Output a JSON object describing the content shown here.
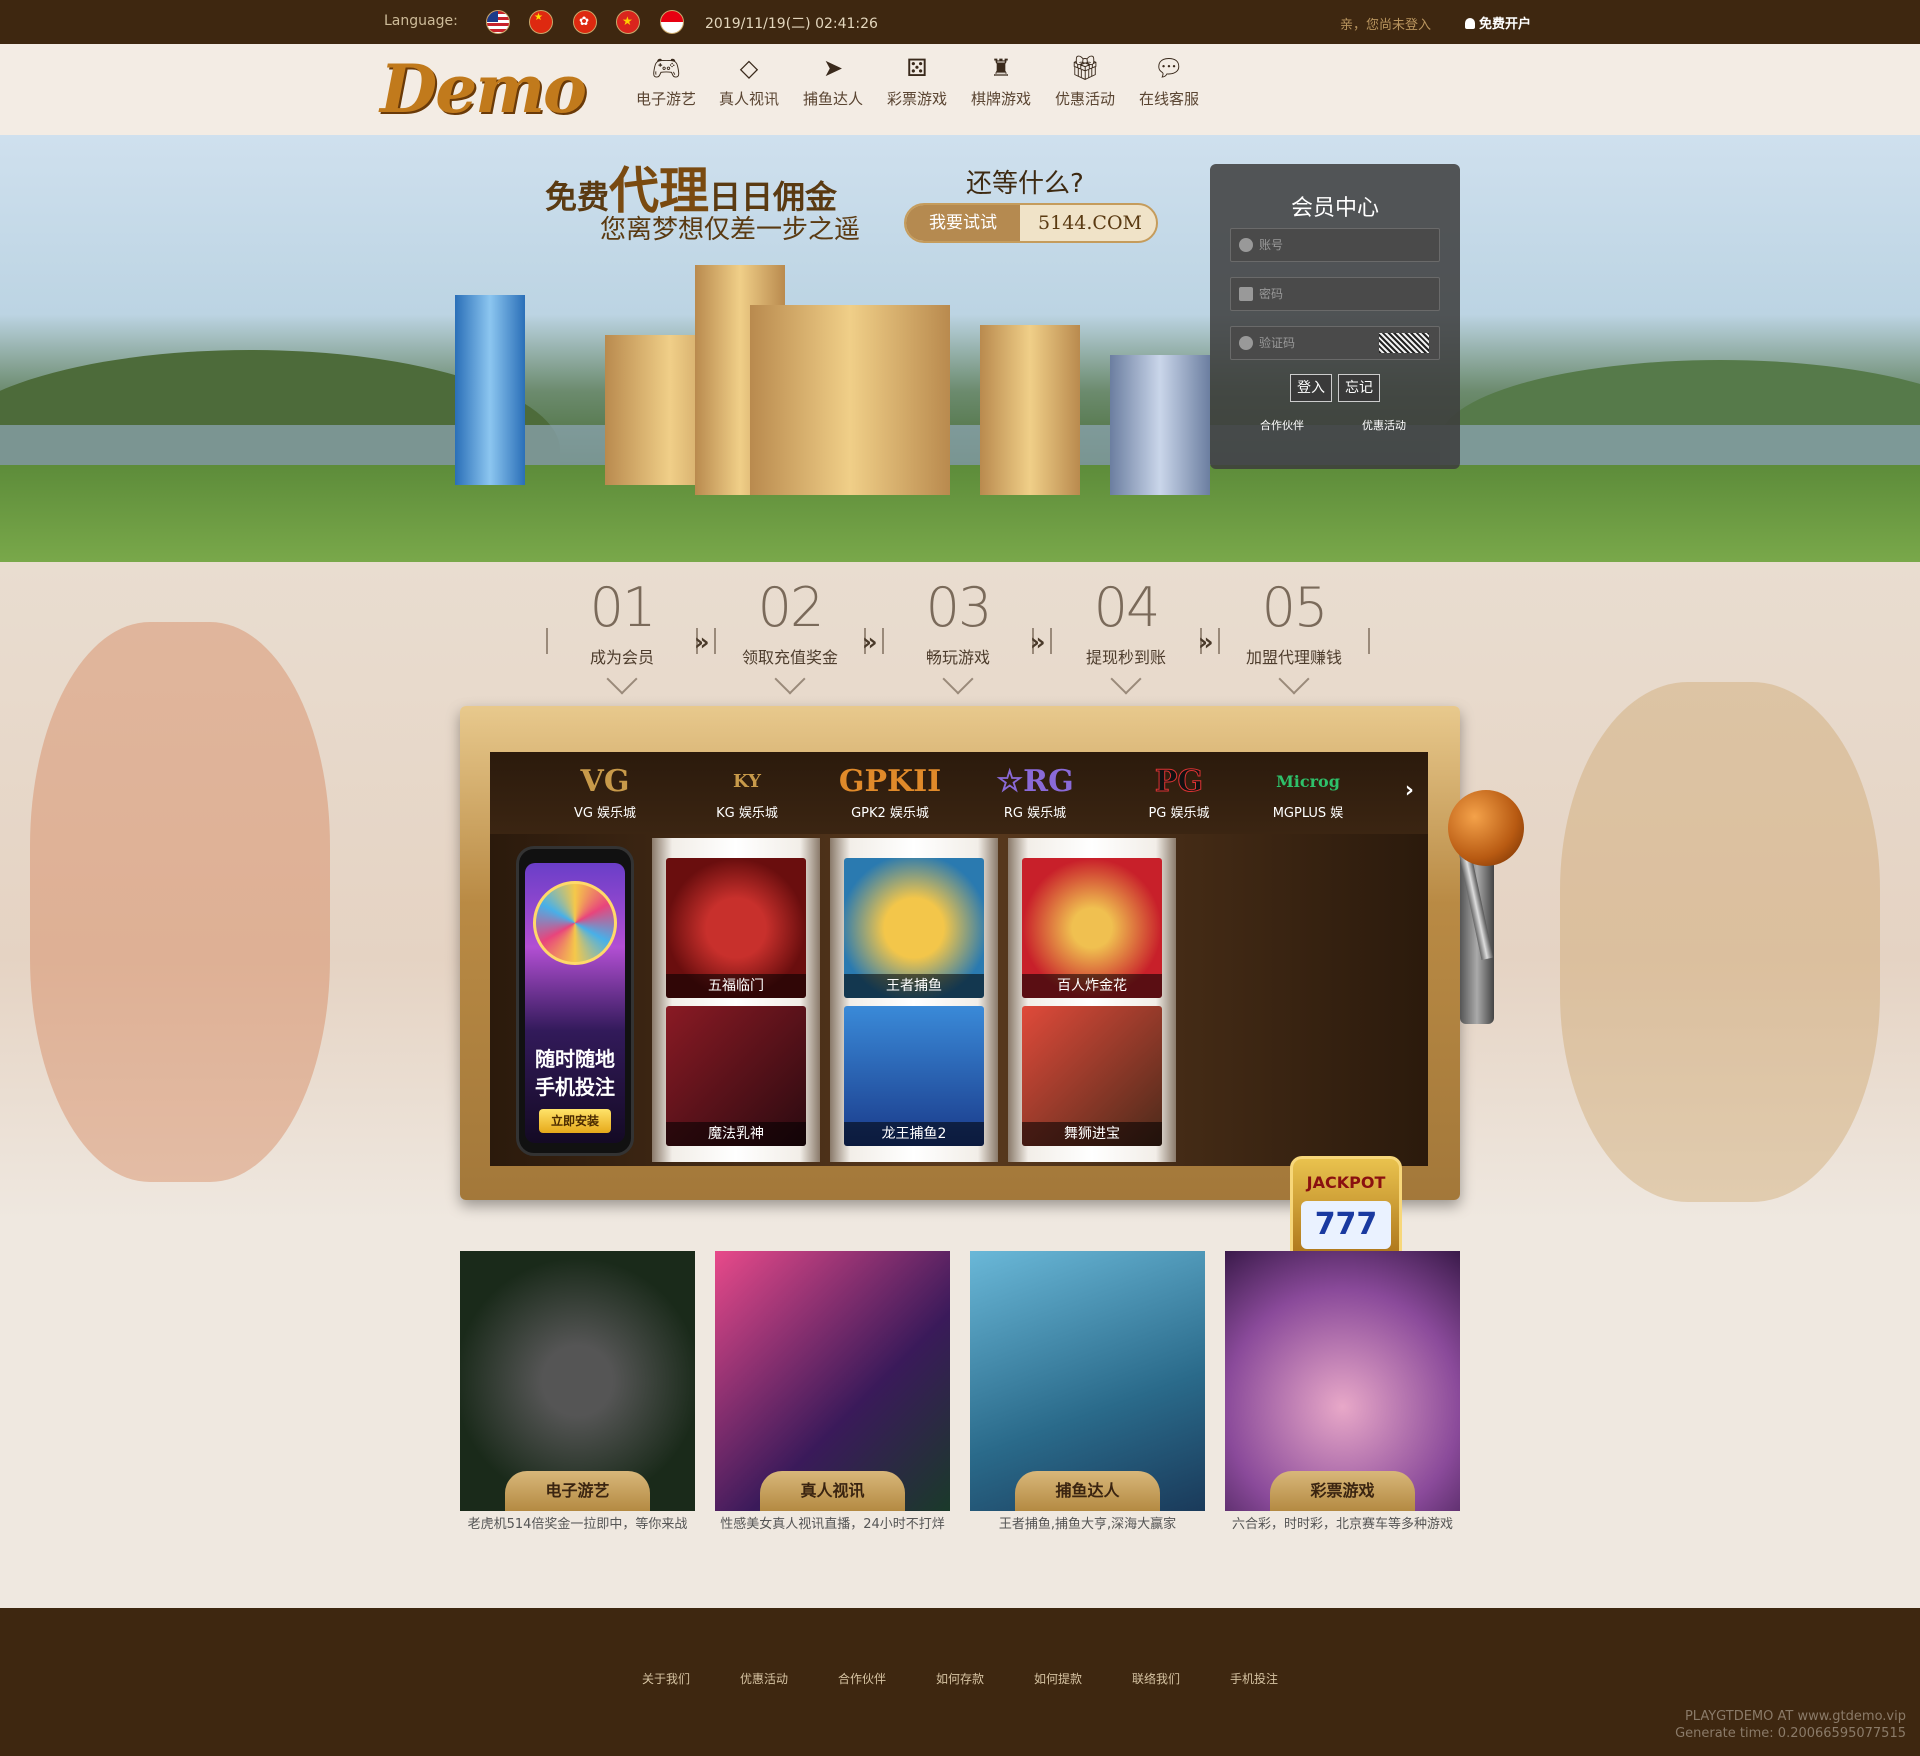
{
  "topbar": {
    "language_label": "Language:",
    "flags": [
      "us-flag-icon",
      "cn-flag-icon",
      "hk-flag-icon",
      "vn-flag-icon",
      "id-flag-icon"
    ],
    "datetime": "2019/11/19(二) 02:41:26",
    "login_hint": "亲，您尚未登入",
    "register_label": "免费开户"
  },
  "header": {
    "logo": "Demo",
    "nav": [
      {
        "label": "电子游艺",
        "icon": "gamepad-icon"
      },
      {
        "label": "真人视讯",
        "icon": "diamond-icon"
      },
      {
        "label": "捕鱼达人",
        "icon": "fish-icon"
      },
      {
        "label": "彩票游戏",
        "icon": "dice-icon"
      },
      {
        "label": "棋牌游戏",
        "icon": "chess-icon"
      },
      {
        "label": "优惠活动",
        "icon": "gift-icon"
      },
      {
        "label": "在线客服",
        "icon": "chat-icon"
      }
    ]
  },
  "banner": {
    "headline_a": "免费",
    "headline_b": "代理",
    "headline_c": "日日佣金",
    "subline": "您离梦想仅差一步之遥",
    "question": "还等什么?",
    "try_label": "我要试试",
    "site": "5144.COM"
  },
  "login": {
    "title": "会员中心",
    "account_placeholder": "账号",
    "password_placeholder": "密码",
    "captcha_placeholder": "验证码",
    "login_button": "登入",
    "forgot_button": "忘记",
    "partner_link": "合作伙伴",
    "promo_link": "优惠活动"
  },
  "steps": [
    {
      "num": "01",
      "label": "成为会员"
    },
    {
      "num": "02",
      "label": "领取充值奖金"
    },
    {
      "num": "03",
      "label": "畅玩游戏"
    },
    {
      "num": "04",
      "label": "提现秒到账"
    },
    {
      "num": "05",
      "label": "加盟代理赚钱"
    }
  ],
  "providers": [
    {
      "logo": "VG",
      "name": "VG 娱乐城"
    },
    {
      "logo": "KY",
      "name": "KG 娱乐城"
    },
    {
      "logo": "GPKII",
      "name": "GPK2 娱乐城"
    },
    {
      "logo": "☆RG",
      "name": "RG 娱乐城"
    },
    {
      "logo": "PG",
      "name": "PG 娱乐城"
    },
    {
      "logo": "Microg",
      "name": "MGPLUS 娱"
    }
  ],
  "phone_promo": {
    "line1": "随时随地",
    "line2": "手机投注",
    "install_label": "立即安装"
  },
  "games": [
    {
      "title": "五福临门"
    },
    {
      "title": "魔法乳神"
    },
    {
      "title": "王者捕鱼"
    },
    {
      "title": "龙王捕鱼2"
    },
    {
      "title": "百人炸金花"
    },
    {
      "title": "舞狮进宝"
    }
  ],
  "jackpot": {
    "label": "JACKPOT",
    "sevens": "777"
  },
  "categories": [
    {
      "title": "电子游艺",
      "desc": "老虎机514倍奖金一拉即中，等你来战"
    },
    {
      "title": "真人视讯",
      "desc": "性感美女真人视讯直播，24小时不打烊"
    },
    {
      "title": "捕鱼达人",
      "desc": "王者捕鱼,捕鱼大亨,深海大赢家"
    },
    {
      "title": "彩票游戏",
      "desc": "六合彩，时时彩，北京赛车等多种游戏"
    }
  ],
  "footer": {
    "links": [
      "关于我们",
      "优惠活动",
      "合作伙伴",
      "如何存款",
      "如何提款",
      "联络我们",
      "手机投注"
    ],
    "credit_line1": "PLAYGTDEMO AT www.gtdemo.vip",
    "credit_line2": "Generate time: 0.20066595077515"
  },
  "colors": {
    "topbar_bg": "#3e2710",
    "accent_gold": "#c59c5c",
    "page_bg": "#efe8e0"
  }
}
